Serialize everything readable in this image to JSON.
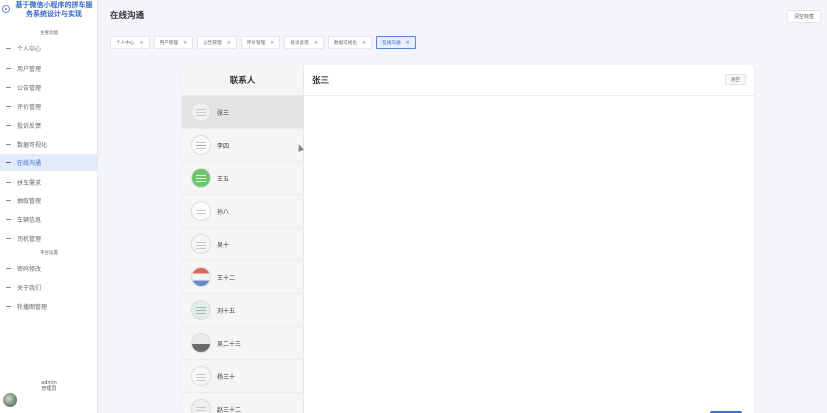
{
  "sidebar": {
    "app_title": "基于微信小程序的拼车服务系统设计与实现",
    "group_main": "主要功能",
    "group_platform": "平台设置",
    "items": [
      {
        "label": "个人中心"
      },
      {
        "label": "用户管理"
      },
      {
        "label": "公告管理"
      },
      {
        "label": "评价管理"
      },
      {
        "label": "投诉反馈"
      },
      {
        "label": "数据可视化"
      },
      {
        "label": "在线沟通"
      },
      {
        "label": "拼车需求"
      },
      {
        "label": "抽取管理"
      },
      {
        "label": "车辆信息"
      },
      {
        "label": "司机管理"
      },
      {
        "label": "密码修改"
      },
      {
        "label": "关于我们"
      },
      {
        "label": "轮播图管理"
      }
    ],
    "active_item": "在线沟通",
    "user": {
      "name": "admin",
      "role": "管理员"
    }
  },
  "header": {
    "page_title": "在线沟通",
    "clear_tags_label": "清空标签"
  },
  "tags": [
    {
      "label": "个人中心",
      "close": "×"
    },
    {
      "label": "用户管理",
      "close": "×"
    },
    {
      "label": "公告管理",
      "close": "×"
    },
    {
      "label": "评价管理",
      "close": "×"
    },
    {
      "label": "投诉反馈",
      "close": "×"
    },
    {
      "label": "数据可视化",
      "close": "×"
    },
    {
      "label": "在线沟通",
      "close": "×"
    }
  ],
  "chat": {
    "contacts_title": "联系人",
    "contacts": [
      {
        "name": "张三"
      },
      {
        "name": "李四"
      },
      {
        "name": "王五"
      },
      {
        "name": "孙八"
      },
      {
        "name": "吴十"
      },
      {
        "name": "王十二"
      },
      {
        "name": "刘十五"
      },
      {
        "name": "吴二十三"
      },
      {
        "name": "杨三十"
      },
      {
        "name": "赵三十二"
      }
    ],
    "selected_contact": "张三",
    "conversation_title": "张三",
    "clear_label": "清空"
  },
  "colors": {
    "accent": "#3a68c9",
    "active_bg": "#e3ebfb"
  }
}
